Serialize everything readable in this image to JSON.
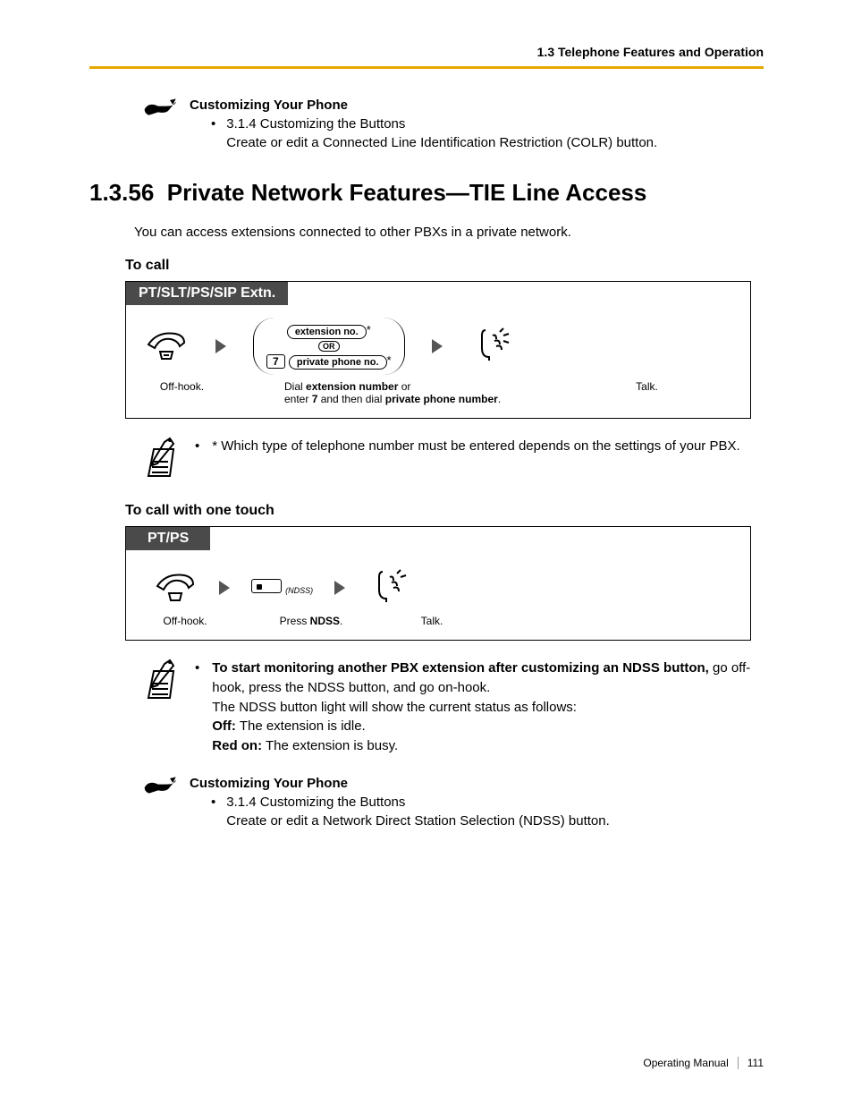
{
  "header": {
    "section": "1.3 Telephone Features and Operation"
  },
  "callout1": {
    "title": "Customizing Your Phone",
    "line1": "3.1.4 Customizing the Buttons",
    "line2": "Create or edit a Connected Line Identification Restriction (COLR) button."
  },
  "section": {
    "number": "1.3.56",
    "title": "Private Network Features—TIE Line Access",
    "intro": "You can access extensions connected to other PBXs in a private network."
  },
  "proc1": {
    "subhead": "To call",
    "tab": "PT/SLT/PS/SIP Extn.",
    "ext_no": "extension no.",
    "or": "OR",
    "key7": "7",
    "private_no": "private phone no.",
    "offhook": "Off-hook.",
    "dial_a": "Dial ",
    "dial_b": "extension number",
    "dial_c": " or",
    "dial_d": "enter ",
    "dial_e": "7",
    "dial_f": " and then dial ",
    "dial_g": "private phone number",
    "dial_h": ".",
    "talk": "Talk."
  },
  "note1": {
    "text": "* Which type of telephone number must be entered depends on the settings of your PBX."
  },
  "proc2": {
    "subhead": "To call with one touch",
    "tab": "PT/PS",
    "ndss": "(NDSS)",
    "offhook": "Off-hook.",
    "press_a": "Press ",
    "press_b": "NDSS",
    "press_c": ".",
    "talk": "Talk."
  },
  "note2": {
    "line1a": "To start monitoring another PBX extension after customizing an NDSS button,",
    "line1b": " go off-hook, press the NDSS button, and go on-hook.",
    "line2": "The NDSS button light will show the current status as follows:",
    "off_a": "Off:",
    "off_b": " The extension is idle.",
    "red_a": "Red on:",
    "red_b": " The extension is busy."
  },
  "callout2": {
    "title": "Customizing Your Phone",
    "line1": "3.1.4 Customizing the Buttons",
    "line2": "Create or edit a Network Direct Station Selection (NDSS) button."
  },
  "footer": {
    "label": "Operating Manual",
    "page": "111"
  }
}
